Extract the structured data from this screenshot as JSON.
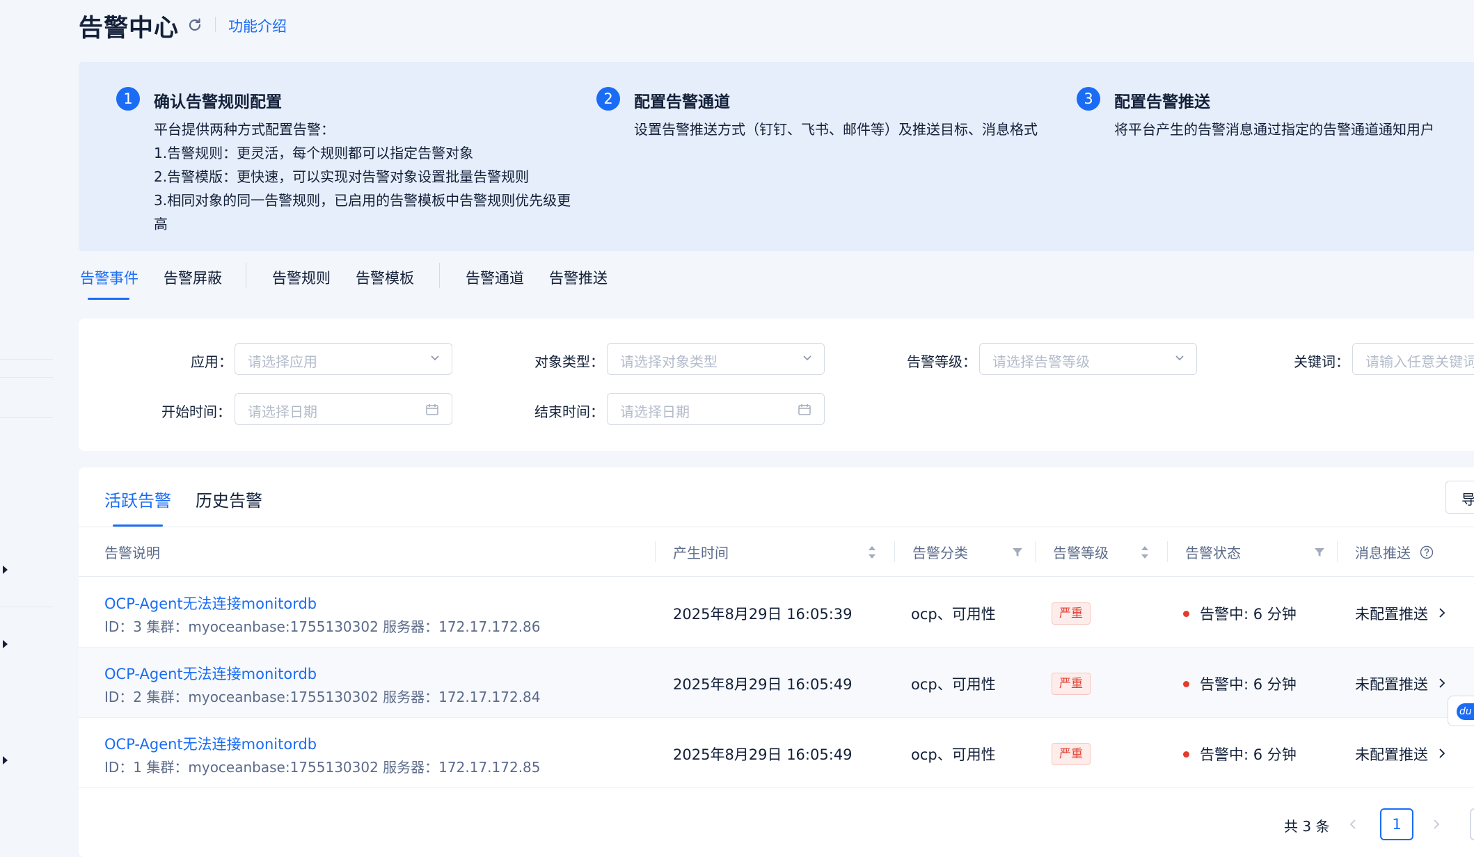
{
  "header": {
    "title": "告警中心",
    "intro_link": "功能介绍"
  },
  "guide": {
    "steps": [
      {
        "num": "1",
        "title": "确认告警规则配置",
        "lines": [
          "平台提供两种方式配置告警：",
          "1.告警规则：更灵活，每个规则都可以指定告警对象",
          "2.告警模版：更快速，可以实现对告警对象设置批量告警规则",
          "3.相同对象的同一告警规则，已启用的告警模板中告警规则优先级更",
          "高"
        ]
      },
      {
        "num": "2",
        "title": "配置告警通道",
        "lines": [
          "设置告警推送方式（钉钉、飞书、邮件等）及推送目标、消息格式"
        ]
      },
      {
        "num": "3",
        "title": "配置告警推送",
        "lines": [
          "将平台产生的告警消息通过指定的告警通道通知用户"
        ]
      }
    ]
  },
  "main_tabs": [
    "告警事件",
    "告警屏蔽",
    "告警规则",
    "告警模板",
    "告警通道",
    "告警推送"
  ],
  "main_tab_active": "告警事件",
  "filters": {
    "app": {
      "label": "应用：",
      "placeholder": "请选择应用"
    },
    "object_type": {
      "label": "对象类型：",
      "placeholder": "请选择对象类型"
    },
    "level": {
      "label": "告警等级：",
      "placeholder": "请选择告警等级"
    },
    "keyword": {
      "label": "关键词：",
      "placeholder": "请输入任意关键词"
    },
    "start_time": {
      "label": "开始时间：",
      "placeholder": "请选择日期"
    },
    "end_time": {
      "label": "结束时间：",
      "placeholder": "请选择日期"
    }
  },
  "sub_tabs": [
    "活跃告警",
    "历史告警"
  ],
  "sub_tab_active": "活跃告警",
  "export_label": "导",
  "table": {
    "columns": [
      "告警说明",
      "产生时间",
      "告警分类",
      "告警等级",
      "告警状态",
      "消息推送"
    ],
    "rows": [
      {
        "title": "OCP-Agent无法连接monitordb",
        "meta": "ID：3  集群：myoceanbase:1755130302  服务器：172.17.172.86",
        "time": "2025年8月29日 16:05:39",
        "category": "ocp、可用性",
        "level": "严重",
        "status": "告警中: 6 分钟",
        "push": "未配置推送"
      },
      {
        "title": "OCP-Agent无法连接monitordb",
        "meta": "ID：2  集群：myoceanbase:1755130302  服务器：172.17.172.84",
        "time": "2025年8月29日 16:05:49",
        "category": "ocp、可用性",
        "level": "严重",
        "status": "告警中: 6 分钟",
        "push": "未配置推送"
      },
      {
        "title": "OCP-Agent无法连接monitordb",
        "meta": "ID：1  集群：myoceanbase:1755130302  服务器：172.17.172.85",
        "time": "2025年8月29日 16:05:49",
        "category": "ocp、可用性",
        "level": "严重",
        "status": "告警中: 6 分钟",
        "push": "未配置推送"
      }
    ]
  },
  "pagination": {
    "total": "共 3 条",
    "current": "1"
  },
  "float_badge": "du",
  "colors": {
    "accent": "#1a6cf5",
    "danger": "#e13d2f",
    "panel": "#e6eefb",
    "background": "#f3f6fb"
  }
}
